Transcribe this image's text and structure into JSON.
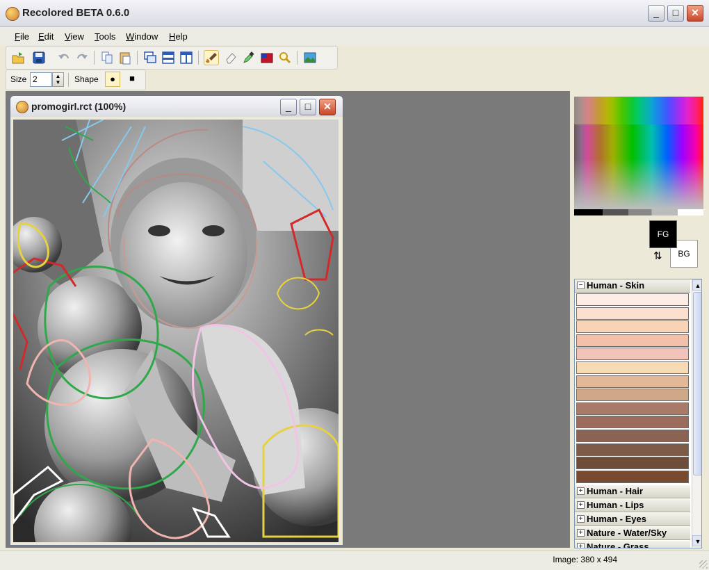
{
  "app": {
    "title": "Recolored BETA 0.6.0"
  },
  "window_buttons": {
    "minimize": "_",
    "maximize": "□",
    "close": "✕"
  },
  "menu": [
    "File",
    "Edit",
    "View",
    "Tools",
    "Window",
    "Help"
  ],
  "toolbar": {
    "icons": [
      "open-icon",
      "save-icon",
      "undo-icon",
      "redo-icon",
      "copy-icon",
      "paste-icon",
      "cascade-icon",
      "tile-horizontal-icon",
      "tile-vertical-icon",
      "brush-icon",
      "eraser-icon",
      "eyedropper-icon",
      "color-fill-icon",
      "zoom-icon",
      "preview-icon"
    ]
  },
  "options": {
    "size_label": "Size",
    "size_value": "2",
    "shape_label": "Shape",
    "shape_circle": "●",
    "shape_square": "■"
  },
  "document": {
    "title": "promogirl.rct (100%)"
  },
  "colors": {
    "fg_label": "FG",
    "bg_label": "BG",
    "fg": "#000000",
    "bg": "#ffffff"
  },
  "palette": {
    "categories": [
      {
        "label": "Human - Skin",
        "expanded": true,
        "toggle": "−"
      },
      {
        "label": "Human - Hair",
        "expanded": false,
        "toggle": "+"
      },
      {
        "label": "Human - Lips",
        "expanded": false,
        "toggle": "+"
      },
      {
        "label": "Human - Eyes",
        "expanded": false,
        "toggle": "+"
      },
      {
        "label": "Nature - Water/Sky",
        "expanded": false,
        "toggle": "+"
      },
      {
        "label": "Nature - Grass",
        "expanded": false,
        "toggle": "+"
      }
    ],
    "skin_swatches": [
      "#fdece3",
      "#fbe0d0",
      "#f8d3b5",
      "#f2c0a8",
      "#f2c3b8",
      "#f5dab4",
      "#e3b896",
      "#cfa888",
      "#a97a68",
      "#9c6c5c",
      "#8a6352",
      "#7e5a48",
      "#6e4c3a",
      "#7a4a30"
    ]
  },
  "status": {
    "image_size": "Image: 380 x 494"
  }
}
